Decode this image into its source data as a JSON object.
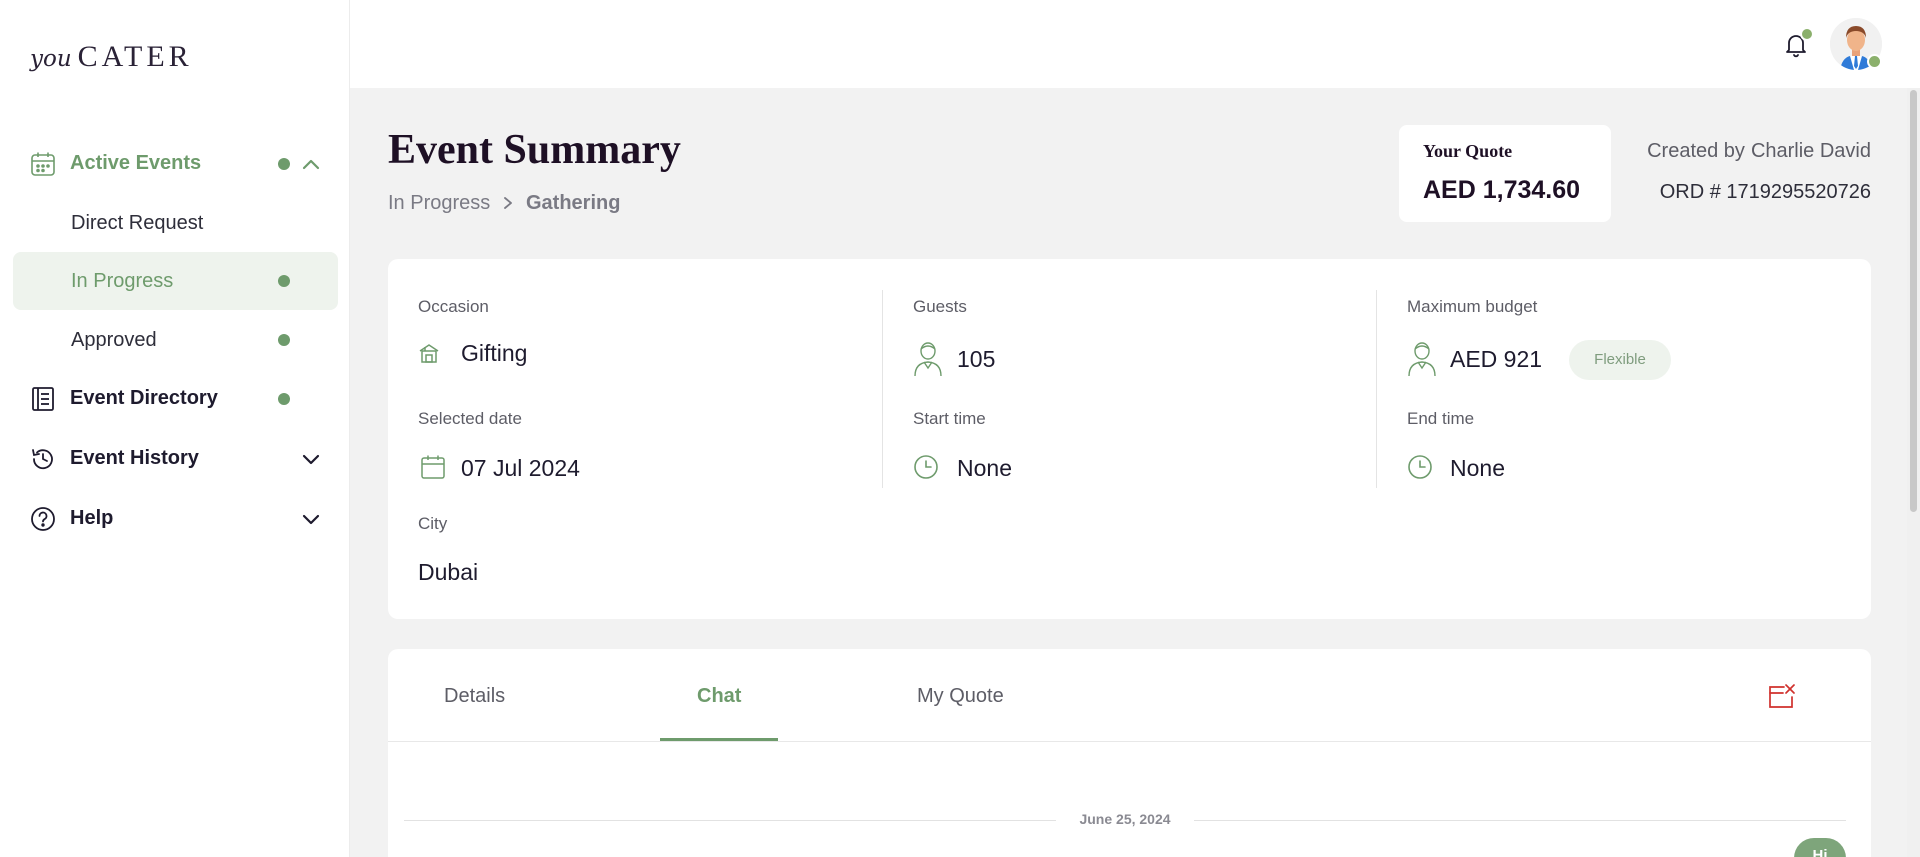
{
  "app": {
    "logo_you": "you",
    "logo_cater": "CATER"
  },
  "sidebar": {
    "active_events": "Active Events",
    "sub_items": [
      {
        "label": "Direct Request"
      },
      {
        "label": "In Progress"
      },
      {
        "label": "Approved"
      }
    ],
    "event_directory": "Event Directory",
    "event_history": "Event History",
    "help": "Help"
  },
  "header": {
    "title": "Event Summary",
    "breadcrumb": [
      "In Progress",
      "Gathering"
    ],
    "quote_label": "Your Quote",
    "quote_value": "AED 1,734.60",
    "created_by_label": "Created by",
    "created_by_name": "Charlie David",
    "order_number": "ORD # 1719295520726"
  },
  "summary": {
    "occasion_label": "Occasion",
    "occasion_value": "Gifting",
    "guests_label": "Guests",
    "guests_value": "105",
    "budget_label": "Maximum budget",
    "budget_value": "AED 921",
    "budget_badge": "Flexible",
    "date_label": "Selected date",
    "date_value": "07 Jul 2024",
    "start_label": "Start time",
    "start_value": "None",
    "end_label": "End time",
    "end_value": "None",
    "city_label": "City",
    "city_value": "Dubai"
  },
  "tabs": {
    "items": [
      "Details",
      "Chat",
      "My Quote"
    ],
    "active": "Chat"
  },
  "chat": {
    "date": "June 25, 2024",
    "bubble_preview": "Hi"
  },
  "colors": {
    "accent": "#6e9b6c",
    "accent_light": "#eef3ed",
    "danger": "#d0312d"
  }
}
